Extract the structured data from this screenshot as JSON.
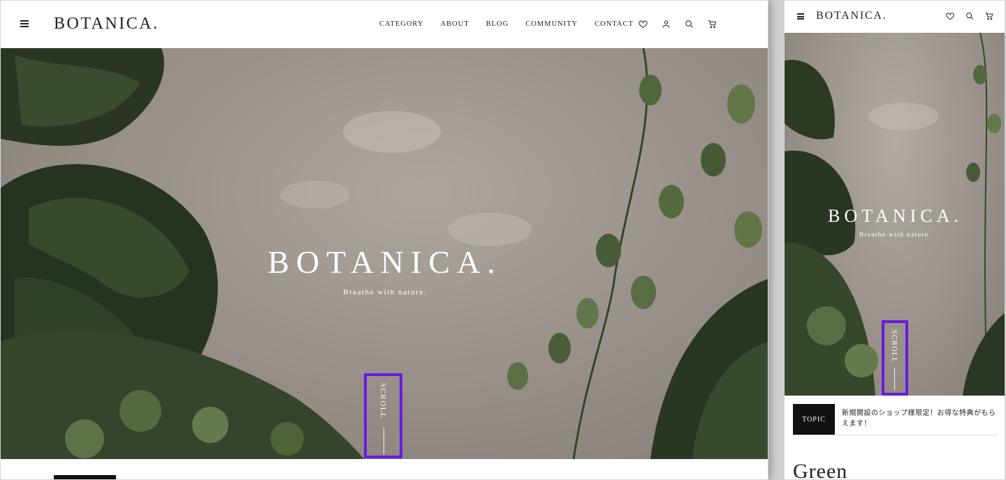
{
  "desktop": {
    "logo": "BOTANICA.",
    "nav": [
      "CATEGORY",
      "ABOUT",
      "BLOG",
      "COMMUNITY",
      "CONTACT"
    ],
    "icons": [
      "heart-icon",
      "user-icon",
      "search-icon",
      "cart-icon"
    ],
    "hero": {
      "title": "BOTANICA.",
      "subtitle": "Breathe with nature.",
      "scroll": "SCROLL"
    }
  },
  "mobile": {
    "logo": "BOTANICA.",
    "icons": [
      "heart-icon",
      "search-icon",
      "cart-icon"
    ],
    "hero": {
      "title": "BOTANICA.",
      "subtitle": "Breathe with nature.",
      "scroll": "SCROLL"
    },
    "topic": {
      "badge": "TOPIC",
      "text": "新規開設のショップ様限定！お得な特典がもらえます！"
    },
    "section_heading": "Green"
  },
  "colors": {
    "highlight": "#6a1be0",
    "text": "#222222",
    "badge_bg": "#111111"
  }
}
